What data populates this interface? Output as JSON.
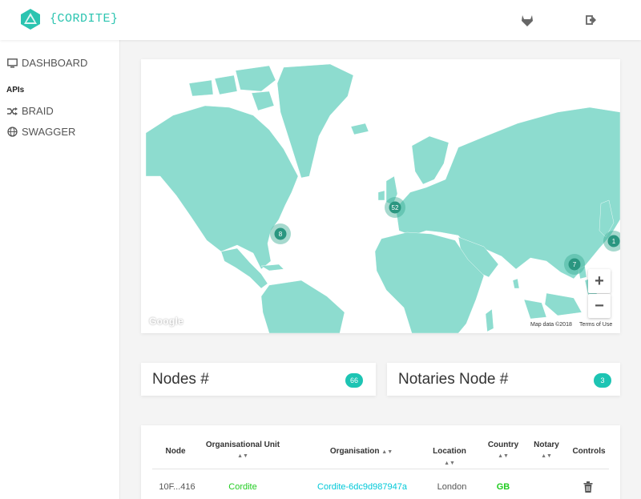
{
  "header": {
    "brand": "{CORDITE}",
    "icons": [
      "gitlab-icon",
      "sign-out-icon"
    ]
  },
  "sidebar": {
    "dashboard": "DASHBOARD",
    "apis_heading": "APIs",
    "braid": "BRAID",
    "swagger": "SWAGGER"
  },
  "map": {
    "clusters": [
      {
        "label": "8",
        "region": "North America (east coast)"
      },
      {
        "label": "52",
        "region": "Western Europe"
      },
      {
        "label": "7",
        "region": "South-East Asia"
      },
      {
        "label": "1",
        "region": "Japan"
      }
    ],
    "zoom_in": "+",
    "zoom_out": "−",
    "google": "Google",
    "map_data": "Map data ©2018",
    "terms": "Terms of Use"
  },
  "stats": {
    "nodes_label": "Nodes #",
    "nodes_count": "66",
    "notaries_label": "Notaries Node #",
    "notaries_count": "3"
  },
  "table": {
    "headers": {
      "node": "Node",
      "org_unit": "Organisational Unit",
      "organisation": "Organisation",
      "location": "Location",
      "country": "Country",
      "notary": "Notary",
      "controls": "Controls"
    },
    "sort_glyph": "▲▼",
    "rows": [
      {
        "node": "10F...416",
        "org_unit": "Cordite",
        "organisation": "Cordite-6dc9d987947a",
        "location": "London",
        "country": "GB",
        "notary": ""
      }
    ]
  },
  "colors": {
    "accent": "#2bc4b0",
    "land": "#8ddccf",
    "badge": "#1dc4b3",
    "green_text": "#22cc22",
    "cyan_text": "#00c8d8"
  }
}
